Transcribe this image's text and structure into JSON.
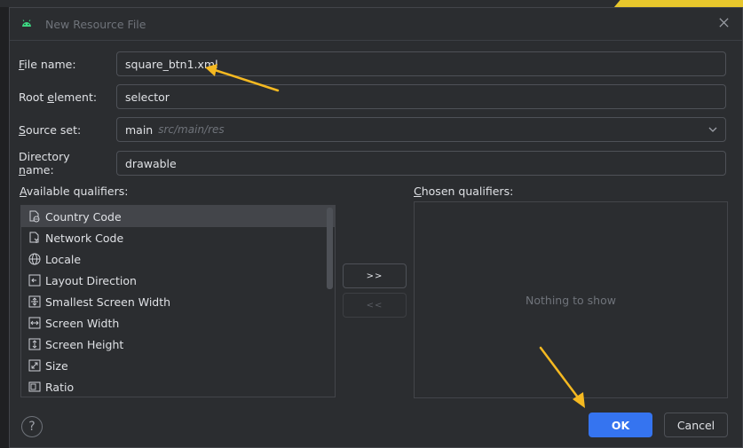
{
  "dialog": {
    "title": "New Resource File"
  },
  "form": {
    "file_name": {
      "label_first": "F",
      "label_rest": "ile name:",
      "value": "square_btn1.xml"
    },
    "root_element": {
      "label_first": "Root ",
      "label_u": "e",
      "label_rest": "lement:",
      "value": "selector"
    },
    "source_set": {
      "label_first": "S",
      "label_rest": "ource set:",
      "value": "main",
      "hint": "src/main/res"
    },
    "directory_name": {
      "label_first": "Directory ",
      "label_u": "n",
      "label_rest": "ame:",
      "value": "drawable"
    }
  },
  "qualifiers": {
    "available_label_u": "A",
    "available_label_rest": "vailable qualifiers:",
    "chosen_label_first": "C",
    "chosen_label_rest": "hosen qualifiers:",
    "available_items": [
      {
        "label": "Country Code",
        "icon": "country-code-icon"
      },
      {
        "label": "Network Code",
        "icon": "network-code-icon"
      },
      {
        "label": "Locale",
        "icon": "globe-icon"
      },
      {
        "label": "Layout Direction",
        "icon": "layout-direction-icon"
      },
      {
        "label": "Smallest Screen Width",
        "icon": "smallest-width-icon"
      },
      {
        "label": "Screen Width",
        "icon": "screen-width-icon"
      },
      {
        "label": "Screen Height",
        "icon": "screen-height-icon"
      },
      {
        "label": "Size",
        "icon": "size-icon"
      },
      {
        "label": "Ratio",
        "icon": "ratio-icon"
      }
    ],
    "selected_index": 0,
    "add_label": ">>",
    "remove_label": "<<",
    "chosen_empty": "Nothing to show"
  },
  "footer": {
    "help_label": "?",
    "ok_label": "OK",
    "cancel_label": "Cancel"
  },
  "colors": {
    "accent": "#3574f0",
    "annotation_arrow": "#f5b921"
  }
}
